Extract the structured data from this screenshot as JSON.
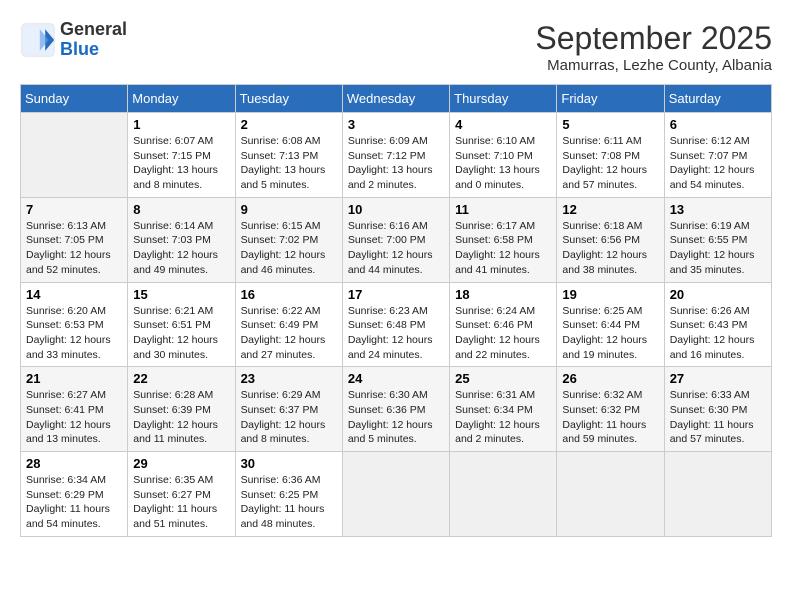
{
  "header": {
    "logo": {
      "general": "General",
      "blue": "Blue"
    },
    "title": "September 2025",
    "subtitle": "Mamurras, Lezhe County, Albania"
  },
  "calendar": {
    "days_of_week": [
      "Sunday",
      "Monday",
      "Tuesday",
      "Wednesday",
      "Thursday",
      "Friday",
      "Saturday"
    ],
    "weeks": [
      [
        {
          "day": "",
          "sunrise": "",
          "sunset": "",
          "daylight": ""
        },
        {
          "day": "1",
          "sunrise": "Sunrise: 6:07 AM",
          "sunset": "Sunset: 7:15 PM",
          "daylight": "Daylight: 13 hours and 8 minutes."
        },
        {
          "day": "2",
          "sunrise": "Sunrise: 6:08 AM",
          "sunset": "Sunset: 7:13 PM",
          "daylight": "Daylight: 13 hours and 5 minutes."
        },
        {
          "day": "3",
          "sunrise": "Sunrise: 6:09 AM",
          "sunset": "Sunset: 7:12 PM",
          "daylight": "Daylight: 13 hours and 2 minutes."
        },
        {
          "day": "4",
          "sunrise": "Sunrise: 6:10 AM",
          "sunset": "Sunset: 7:10 PM",
          "daylight": "Daylight: 13 hours and 0 minutes."
        },
        {
          "day": "5",
          "sunrise": "Sunrise: 6:11 AM",
          "sunset": "Sunset: 7:08 PM",
          "daylight": "Daylight: 12 hours and 57 minutes."
        },
        {
          "day": "6",
          "sunrise": "Sunrise: 6:12 AM",
          "sunset": "Sunset: 7:07 PM",
          "daylight": "Daylight: 12 hours and 54 minutes."
        }
      ],
      [
        {
          "day": "7",
          "sunrise": "Sunrise: 6:13 AM",
          "sunset": "Sunset: 7:05 PM",
          "daylight": "Daylight: 12 hours and 52 minutes."
        },
        {
          "day": "8",
          "sunrise": "Sunrise: 6:14 AM",
          "sunset": "Sunset: 7:03 PM",
          "daylight": "Daylight: 12 hours and 49 minutes."
        },
        {
          "day": "9",
          "sunrise": "Sunrise: 6:15 AM",
          "sunset": "Sunset: 7:02 PM",
          "daylight": "Daylight: 12 hours and 46 minutes."
        },
        {
          "day": "10",
          "sunrise": "Sunrise: 6:16 AM",
          "sunset": "Sunset: 7:00 PM",
          "daylight": "Daylight: 12 hours and 44 minutes."
        },
        {
          "day": "11",
          "sunrise": "Sunrise: 6:17 AM",
          "sunset": "Sunset: 6:58 PM",
          "daylight": "Daylight: 12 hours and 41 minutes."
        },
        {
          "day": "12",
          "sunrise": "Sunrise: 6:18 AM",
          "sunset": "Sunset: 6:56 PM",
          "daylight": "Daylight: 12 hours and 38 minutes."
        },
        {
          "day": "13",
          "sunrise": "Sunrise: 6:19 AM",
          "sunset": "Sunset: 6:55 PM",
          "daylight": "Daylight: 12 hours and 35 minutes."
        }
      ],
      [
        {
          "day": "14",
          "sunrise": "Sunrise: 6:20 AM",
          "sunset": "Sunset: 6:53 PM",
          "daylight": "Daylight: 12 hours and 33 minutes."
        },
        {
          "day": "15",
          "sunrise": "Sunrise: 6:21 AM",
          "sunset": "Sunset: 6:51 PM",
          "daylight": "Daylight: 12 hours and 30 minutes."
        },
        {
          "day": "16",
          "sunrise": "Sunrise: 6:22 AM",
          "sunset": "Sunset: 6:49 PM",
          "daylight": "Daylight: 12 hours and 27 minutes."
        },
        {
          "day": "17",
          "sunrise": "Sunrise: 6:23 AM",
          "sunset": "Sunset: 6:48 PM",
          "daylight": "Daylight: 12 hours and 24 minutes."
        },
        {
          "day": "18",
          "sunrise": "Sunrise: 6:24 AM",
          "sunset": "Sunset: 6:46 PM",
          "daylight": "Daylight: 12 hours and 22 minutes."
        },
        {
          "day": "19",
          "sunrise": "Sunrise: 6:25 AM",
          "sunset": "Sunset: 6:44 PM",
          "daylight": "Daylight: 12 hours and 19 minutes."
        },
        {
          "day": "20",
          "sunrise": "Sunrise: 6:26 AM",
          "sunset": "Sunset: 6:43 PM",
          "daylight": "Daylight: 12 hours and 16 minutes."
        }
      ],
      [
        {
          "day": "21",
          "sunrise": "Sunrise: 6:27 AM",
          "sunset": "Sunset: 6:41 PM",
          "daylight": "Daylight: 12 hours and 13 minutes."
        },
        {
          "day": "22",
          "sunrise": "Sunrise: 6:28 AM",
          "sunset": "Sunset: 6:39 PM",
          "daylight": "Daylight: 12 hours and 11 minutes."
        },
        {
          "day": "23",
          "sunrise": "Sunrise: 6:29 AM",
          "sunset": "Sunset: 6:37 PM",
          "daylight": "Daylight: 12 hours and 8 minutes."
        },
        {
          "day": "24",
          "sunrise": "Sunrise: 6:30 AM",
          "sunset": "Sunset: 6:36 PM",
          "daylight": "Daylight: 12 hours and 5 minutes."
        },
        {
          "day": "25",
          "sunrise": "Sunrise: 6:31 AM",
          "sunset": "Sunset: 6:34 PM",
          "daylight": "Daylight: 12 hours and 2 minutes."
        },
        {
          "day": "26",
          "sunrise": "Sunrise: 6:32 AM",
          "sunset": "Sunset: 6:32 PM",
          "daylight": "Daylight: 11 hours and 59 minutes."
        },
        {
          "day": "27",
          "sunrise": "Sunrise: 6:33 AM",
          "sunset": "Sunset: 6:30 PM",
          "daylight": "Daylight: 11 hours and 57 minutes."
        }
      ],
      [
        {
          "day": "28",
          "sunrise": "Sunrise: 6:34 AM",
          "sunset": "Sunset: 6:29 PM",
          "daylight": "Daylight: 11 hours and 54 minutes."
        },
        {
          "day": "29",
          "sunrise": "Sunrise: 6:35 AM",
          "sunset": "Sunset: 6:27 PM",
          "daylight": "Daylight: 11 hours and 51 minutes."
        },
        {
          "day": "30",
          "sunrise": "Sunrise: 6:36 AM",
          "sunset": "Sunset: 6:25 PM",
          "daylight": "Daylight: 11 hours and 48 minutes."
        },
        {
          "day": "",
          "sunrise": "",
          "sunset": "",
          "daylight": ""
        },
        {
          "day": "",
          "sunrise": "",
          "sunset": "",
          "daylight": ""
        },
        {
          "day": "",
          "sunrise": "",
          "sunset": "",
          "daylight": ""
        },
        {
          "day": "",
          "sunrise": "",
          "sunset": "",
          "daylight": ""
        }
      ]
    ]
  }
}
